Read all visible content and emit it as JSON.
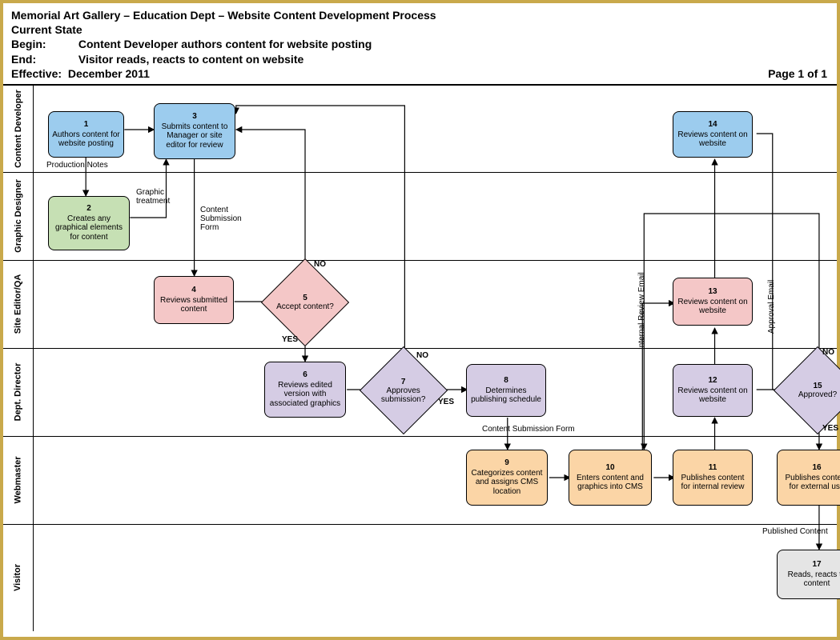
{
  "header": {
    "title": "Memorial Art Gallery – Education Dept – Website Content Development Process",
    "state": "Current State",
    "begin_label": "Begin:",
    "begin": "Content Developer authors content for website posting",
    "end_label": "End:",
    "end": "Visitor reads, reacts to content on website",
    "effective_label": "Effective:",
    "effective": "December 2011",
    "page": "Page 1 of 1"
  },
  "lanes": [
    {
      "id": "content-developer",
      "label": "Content Developer"
    },
    {
      "id": "graphic-designer",
      "label": "Graphic Designer"
    },
    {
      "id": "site-editor-qa",
      "label": "Site Editor/QA"
    },
    {
      "id": "dept-director",
      "label": "Dept. Director"
    },
    {
      "id": "webmaster",
      "label": "Webmaster"
    },
    {
      "id": "visitor",
      "label": "Visitor"
    }
  ],
  "nodes": {
    "n1": {
      "num": "1",
      "text": "Authors content for website posting"
    },
    "n2": {
      "num": "2",
      "text": "Creates any graphical elements for content"
    },
    "n3": {
      "num": "3",
      "text": "Submits content to Manager or site editor for review"
    },
    "n4": {
      "num": "4",
      "text": "Reviews submitted content"
    },
    "n5": {
      "num": "5",
      "text": "Accept content?"
    },
    "n6": {
      "num": "6",
      "text": "Reviews edited version with associated graphics"
    },
    "n7": {
      "num": "7",
      "text": "Approves submission?"
    },
    "n8": {
      "num": "8",
      "text": "Determines publishing schedule"
    },
    "n9": {
      "num": "9",
      "text": "Categorizes content and assigns CMS location"
    },
    "n10": {
      "num": "10",
      "text": "Enters content and graphics into CMS"
    },
    "n11": {
      "num": "11",
      "text": "Publishes content for internal review"
    },
    "n12": {
      "num": "12",
      "text": "Reviews content on website"
    },
    "n13": {
      "num": "13",
      "text": "Reviews content on website"
    },
    "n14": {
      "num": "14",
      "text": "Reviews content on website"
    },
    "n15": {
      "num": "15",
      "text": "Approved?"
    },
    "n16": {
      "num": "16",
      "text": "Publishes content for external use"
    },
    "n17": {
      "num": "17",
      "text": "Reads, reacts to content"
    }
  },
  "edge_labels": {
    "production_notes": "Production Notes",
    "graphic_treatment": "Graphic treatment",
    "content_submission_form": "Content Submission Form",
    "content_submission_form2": "Content Submission Form",
    "yes": "YES",
    "no": "NO",
    "internal_review_email": "Internal Review Email",
    "approval_email": "Approval Email",
    "published_content": "Published Content"
  }
}
